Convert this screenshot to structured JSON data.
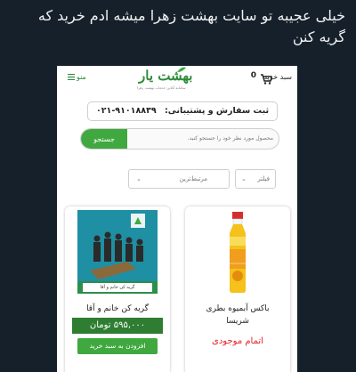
{
  "tweet": {
    "text": "خیلی عجیبه تو سایت بهشت زهرا میشه ادم خرید که گریه کنن"
  },
  "header": {
    "cart_label": "سبد خرید",
    "cart_count": "0",
    "menu_label": "منو",
    "logo_word": "بهشت یار",
    "logo_tagline": "سامانه آنلاین خدمات بهشت زهرا"
  },
  "support": {
    "label": "ثبت سفارش و پشتیبانی:",
    "phone": "۰۲۱-۹۱۰۱۸۸۳۹"
  },
  "search": {
    "placeholder": "محصول مورد نظر خود را جستجو کنید.",
    "button_label": "جستجو"
  },
  "filters": {
    "filter_label": "فیلتر",
    "sort_label": "مرتبط‌ترین"
  },
  "products": [
    {
      "name_line1": "باکس آبمیوه بطری",
      "name_line2": "شریسا",
      "status": "اتمام موجودی"
    },
    {
      "name": "گریه کن خانم و آقا",
      "price": "۵۹۵,۰۰۰ تومان",
      "add_label": "افزودن به سبد خرید",
      "image_caption": "گریه کن خانم و آقا"
    }
  ],
  "colors": {
    "brand_green": "#3fa83f",
    "dark_green": "#2e7d32",
    "out_of_stock": "#e3232b",
    "tweet_bg": "#15202b"
  }
}
